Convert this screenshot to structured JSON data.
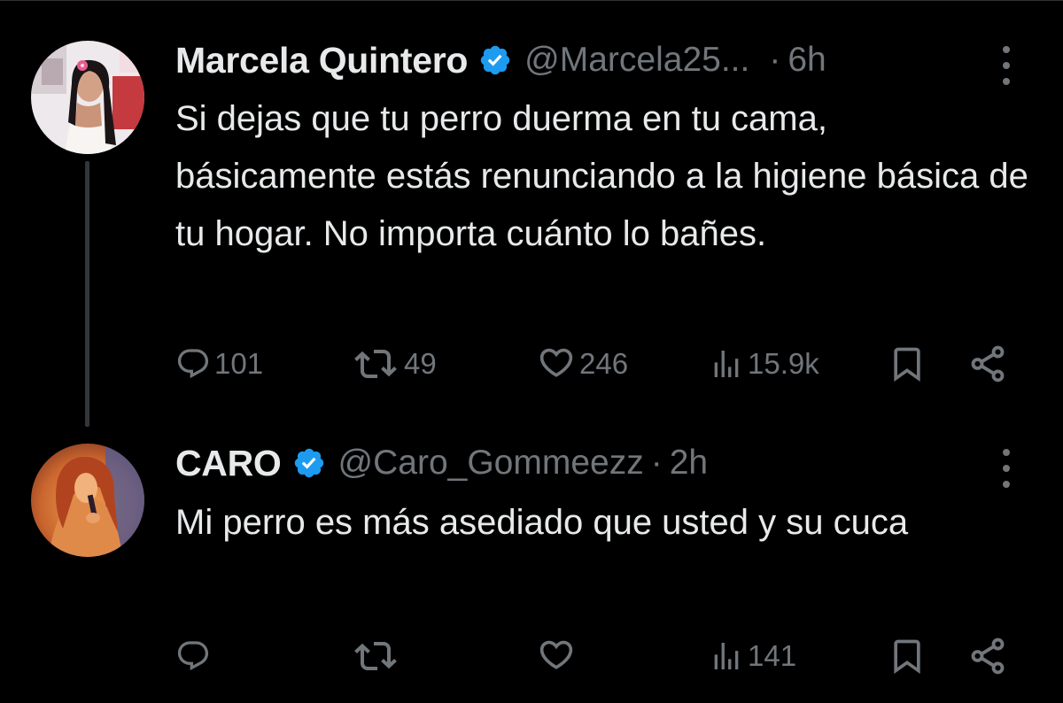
{
  "thread": {
    "tweets": [
      {
        "author": {
          "name": "Marcela Quintero",
          "handle": "@Marcela25...",
          "verified": true
        },
        "separator": "·",
        "time": "6h",
        "text": "Si dejas que tu perro duerma en tu cama, básicamente estás renunciando a la higiene básica de tu hogar. No importa cuánto lo bañes.",
        "stats": {
          "replies": "101",
          "reposts": "49",
          "likes": "246",
          "views": "15.9k"
        }
      },
      {
        "author": {
          "name": "CARO",
          "handle": "@Caro_Gommeezz",
          "verified": true
        },
        "separator": "·",
        "time": "2h",
        "text": "Mi perro es más asediado que usted y su cuca",
        "stats": {
          "replies": "",
          "reposts": "",
          "likes": "",
          "views": "141"
        }
      }
    ]
  },
  "icons": {
    "verified": "verified-badge-icon",
    "more": "more-options-icon",
    "reply": "reply-icon",
    "repost": "repost-icon",
    "like": "like-icon",
    "views": "views-icon",
    "bookmark": "bookmark-icon",
    "share": "share-icon"
  },
  "colors": {
    "background": "#000000",
    "primary_text": "#e7e9ea",
    "secondary_text": "#71767b",
    "verified_blue": "#1d9bf0",
    "thread_line": "#333639"
  }
}
